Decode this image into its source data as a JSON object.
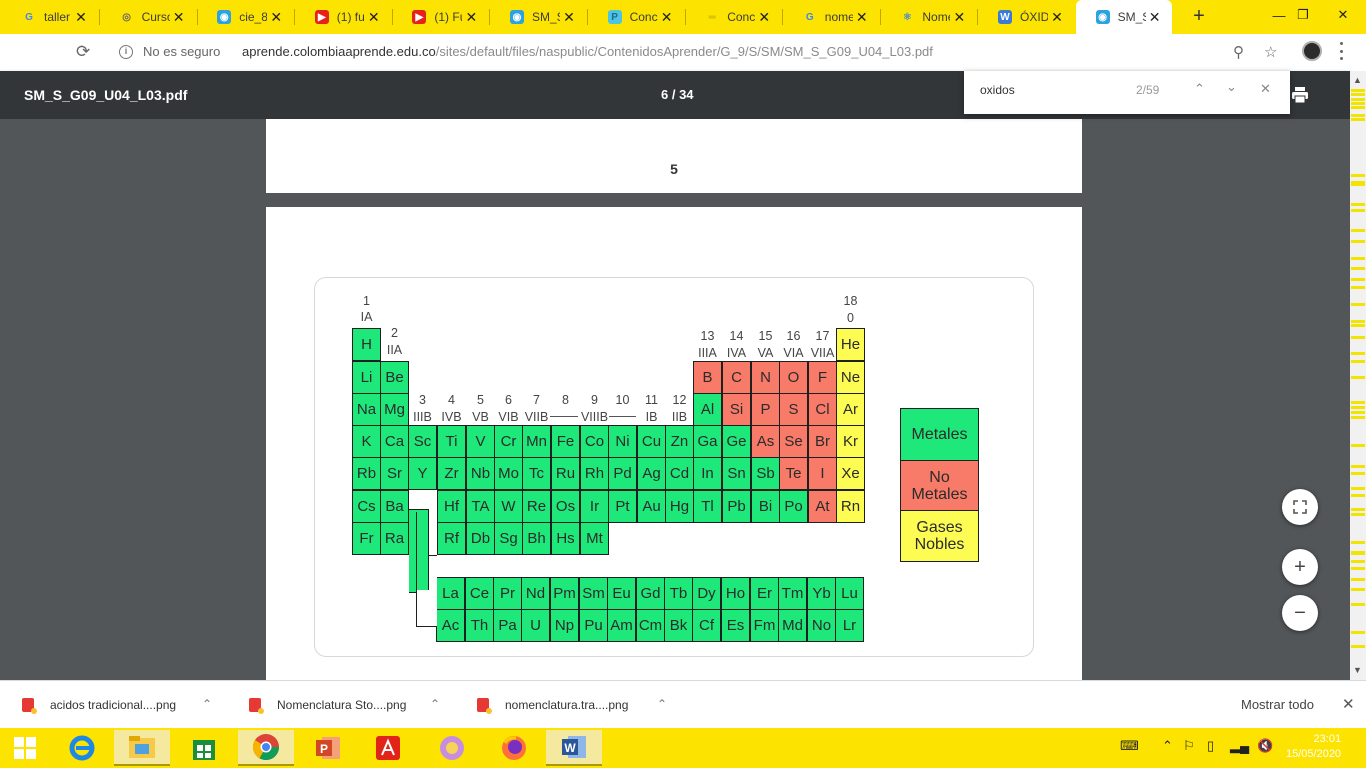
{
  "tabs": [
    {
      "label": "taller",
      "icon": "google-icon",
      "active": false
    },
    {
      "label": "Curso",
      "icon": "globe-icon",
      "active": false
    },
    {
      "label": "cie_8_",
      "icon": "site-icon",
      "active": false
    },
    {
      "label": "(1) fu",
      "icon": "youtube-icon",
      "active": false
    },
    {
      "label": "(1) Fu",
      "icon": "youtube-icon",
      "active": false
    },
    {
      "label": "SM_S",
      "icon": "site-icon",
      "active": false
    },
    {
      "label": "Conce",
      "icon": "p-icon",
      "active": false
    },
    {
      "label": "Conce",
      "icon": "doc-icon",
      "active": false
    },
    {
      "label": "nome",
      "icon": "google-icon",
      "active": false
    },
    {
      "label": "Nome",
      "icon": "atom-icon",
      "active": false
    },
    {
      "label": "ÓXID",
      "icon": "w-icon",
      "active": false
    },
    {
      "label": "SM_S",
      "icon": "site-icon",
      "active": true
    }
  ],
  "address": {
    "security": "No es seguro",
    "host": "aprende.colombiaaprende.edu.co",
    "path": "/sites/default/files/naspublic/ContenidosAprender/G_9/S/SM/SM_S_G09_U04_L03.pdf"
  },
  "pdf": {
    "title": "SM_S_G09_U04_L03.pdf",
    "page_indicator": "6 / 34",
    "page_number": "5"
  },
  "find": {
    "query": "oxidos",
    "count": "2/59"
  },
  "periodic_table": {
    "group_labels": [
      {
        "num": "1",
        "roman": "IA"
      },
      {
        "num": "2",
        "roman": "IIA"
      },
      {
        "num": "3",
        "roman": "IIIB"
      },
      {
        "num": "4",
        "roman": "IVB"
      },
      {
        "num": "5",
        "roman": "VB"
      },
      {
        "num": "6",
        "roman": "VIB"
      },
      {
        "num": "7",
        "roman": "VIIB"
      },
      {
        "num": "8",
        "roman": ""
      },
      {
        "num": "9",
        "roman": "VIIIB"
      },
      {
        "num": "10",
        "roman": ""
      },
      {
        "num": "11",
        "roman": "IB"
      },
      {
        "num": "12",
        "roman": "IIB"
      },
      {
        "num": "13",
        "roman": "IIIA"
      },
      {
        "num": "14",
        "roman": "IVA"
      },
      {
        "num": "15",
        "roman": "VA"
      },
      {
        "num": "16",
        "roman": "VIA"
      },
      {
        "num": "17",
        "roman": "VIIA"
      },
      {
        "num": "18",
        "roman": "0"
      }
    ],
    "elements": [
      {
        "s": "H",
        "r": 1,
        "c": 1,
        "t": "metal"
      },
      {
        "s": "He",
        "r": 1,
        "c": 18,
        "t": "noble"
      },
      {
        "s": "Li",
        "r": 2,
        "c": 1,
        "t": "metal"
      },
      {
        "s": "Be",
        "r": 2,
        "c": 2,
        "t": "metal"
      },
      {
        "s": "B",
        "r": 2,
        "c": 13,
        "t": "nonmetal"
      },
      {
        "s": "C",
        "r": 2,
        "c": 14,
        "t": "nonmetal"
      },
      {
        "s": "N",
        "r": 2,
        "c": 15,
        "t": "nonmetal"
      },
      {
        "s": "O",
        "r": 2,
        "c": 16,
        "t": "nonmetal"
      },
      {
        "s": "F",
        "r": 2,
        "c": 17,
        "t": "nonmetal"
      },
      {
        "s": "Ne",
        "r": 2,
        "c": 18,
        "t": "noble"
      },
      {
        "s": "Na",
        "r": 3,
        "c": 1,
        "t": "metal"
      },
      {
        "s": "Mg",
        "r": 3,
        "c": 2,
        "t": "metal"
      },
      {
        "s": "Al",
        "r": 3,
        "c": 13,
        "t": "metal"
      },
      {
        "s": "Si",
        "r": 3,
        "c": 14,
        "t": "nonmetal"
      },
      {
        "s": "P",
        "r": 3,
        "c": 15,
        "t": "nonmetal"
      },
      {
        "s": "S",
        "r": 3,
        "c": 16,
        "t": "nonmetal"
      },
      {
        "s": "Cl",
        "r": 3,
        "c": 17,
        "t": "nonmetal"
      },
      {
        "s": "Ar",
        "r": 3,
        "c": 18,
        "t": "noble"
      },
      {
        "s": "K",
        "r": 4,
        "c": 1,
        "t": "metal"
      },
      {
        "s": "Ca",
        "r": 4,
        "c": 2,
        "t": "metal"
      },
      {
        "s": "Sc",
        "r": 4,
        "c": 3,
        "t": "metal"
      },
      {
        "s": "Ti",
        "r": 4,
        "c": 4,
        "t": "metal"
      },
      {
        "s": "V",
        "r": 4,
        "c": 5,
        "t": "metal"
      },
      {
        "s": "Cr",
        "r": 4,
        "c": 6,
        "t": "metal"
      },
      {
        "s": "Mn",
        "r": 4,
        "c": 7,
        "t": "metal"
      },
      {
        "s": "Fe",
        "r": 4,
        "c": 8,
        "t": "metal"
      },
      {
        "s": "Co",
        "r": 4,
        "c": 9,
        "t": "metal"
      },
      {
        "s": "Ni",
        "r": 4,
        "c": 10,
        "t": "metal"
      },
      {
        "s": "Cu",
        "r": 4,
        "c": 11,
        "t": "metal"
      },
      {
        "s": "Zn",
        "r": 4,
        "c": 12,
        "t": "metal"
      },
      {
        "s": "Ga",
        "r": 4,
        "c": 13,
        "t": "metal"
      },
      {
        "s": "Ge",
        "r": 4,
        "c": 14,
        "t": "metal"
      },
      {
        "s": "As",
        "r": 4,
        "c": 15,
        "t": "nonmetal"
      },
      {
        "s": "Se",
        "r": 4,
        "c": 16,
        "t": "nonmetal"
      },
      {
        "s": "Br",
        "r": 4,
        "c": 17,
        "t": "nonmetal"
      },
      {
        "s": "Kr",
        "r": 4,
        "c": 18,
        "t": "noble"
      },
      {
        "s": "Rb",
        "r": 5,
        "c": 1,
        "t": "metal"
      },
      {
        "s": "Sr",
        "r": 5,
        "c": 2,
        "t": "metal"
      },
      {
        "s": "Y",
        "r": 5,
        "c": 3,
        "t": "metal"
      },
      {
        "s": "Zr",
        "r": 5,
        "c": 4,
        "t": "metal"
      },
      {
        "s": "Nb",
        "r": 5,
        "c": 5,
        "t": "metal"
      },
      {
        "s": "Mo",
        "r": 5,
        "c": 6,
        "t": "metal"
      },
      {
        "s": "Tc",
        "r": 5,
        "c": 7,
        "t": "metal"
      },
      {
        "s": "Ru",
        "r": 5,
        "c": 8,
        "t": "metal"
      },
      {
        "s": "Rh",
        "r": 5,
        "c": 9,
        "t": "metal"
      },
      {
        "s": "Pd",
        "r": 5,
        "c": 10,
        "t": "metal"
      },
      {
        "s": "Ag",
        "r": 5,
        "c": 11,
        "t": "metal"
      },
      {
        "s": "Cd",
        "r": 5,
        "c": 12,
        "t": "metal"
      },
      {
        "s": "In",
        "r": 5,
        "c": 13,
        "t": "metal"
      },
      {
        "s": "Sn",
        "r": 5,
        "c": 14,
        "t": "metal"
      },
      {
        "s": "Sb",
        "r": 5,
        "c": 15,
        "t": "metal"
      },
      {
        "s": "Te",
        "r": 5,
        "c": 16,
        "t": "nonmetal"
      },
      {
        "s": "I",
        "r": 5,
        "c": 17,
        "t": "nonmetal"
      },
      {
        "s": "Xe",
        "r": 5,
        "c": 18,
        "t": "noble"
      },
      {
        "s": "Cs",
        "r": 6,
        "c": 1,
        "t": "metal"
      },
      {
        "s": "Ba",
        "r": 6,
        "c": 2,
        "t": "metal"
      },
      {
        "s": "Hf",
        "r": 6,
        "c": 4,
        "t": "metal"
      },
      {
        "s": "TA",
        "r": 6,
        "c": 5,
        "t": "metal"
      },
      {
        "s": "W",
        "r": 6,
        "c": 6,
        "t": "metal"
      },
      {
        "s": "Re",
        "r": 6,
        "c": 7,
        "t": "metal"
      },
      {
        "s": "Os",
        "r": 6,
        "c": 8,
        "t": "metal"
      },
      {
        "s": "Ir",
        "r": 6,
        "c": 9,
        "t": "metal"
      },
      {
        "s": "Pt",
        "r": 6,
        "c": 10,
        "t": "metal"
      },
      {
        "s": "Au",
        "r": 6,
        "c": 11,
        "t": "metal"
      },
      {
        "s": "Hg",
        "r": 6,
        "c": 12,
        "t": "metal"
      },
      {
        "s": "Tl",
        "r": 6,
        "c": 13,
        "t": "metal"
      },
      {
        "s": "Pb",
        "r": 6,
        "c": 14,
        "t": "metal"
      },
      {
        "s": "Bi",
        "r": 6,
        "c": 15,
        "t": "metal"
      },
      {
        "s": "Po",
        "r": 6,
        "c": 16,
        "t": "metal"
      },
      {
        "s": "At",
        "r": 6,
        "c": 17,
        "t": "nonmetal"
      },
      {
        "s": "Rn",
        "r": 6,
        "c": 18,
        "t": "noble"
      },
      {
        "s": "Fr",
        "r": 7,
        "c": 1,
        "t": "metal"
      },
      {
        "s": "Ra",
        "r": 7,
        "c": 2,
        "t": "metal"
      },
      {
        "s": "Rf",
        "r": 7,
        "c": 4,
        "t": "metal"
      },
      {
        "s": "Db",
        "r": 7,
        "c": 5,
        "t": "metal"
      },
      {
        "s": "Sg",
        "r": 7,
        "c": 6,
        "t": "metal"
      },
      {
        "s": "Bh",
        "r": 7,
        "c": 7,
        "t": "metal"
      },
      {
        "s": "Hs",
        "r": 7,
        "c": 8,
        "t": "metal"
      },
      {
        "s": "Mt",
        "r": 7,
        "c": 9,
        "t": "metal"
      }
    ],
    "lanthanides": [
      "La",
      "Ce",
      "Pr",
      "Nd",
      "Pm",
      "Sm",
      "Eu",
      "Gd",
      "Tb",
      "Dy",
      "Ho",
      "Er",
      "Tm",
      "Yb",
      "Lu"
    ],
    "actinides": [
      "Ac",
      "Th",
      "Pa",
      "U",
      "Np",
      "Pu",
      "Am",
      "Cm",
      "Bk",
      "Cf",
      "Es",
      "Fm",
      "Md",
      "No",
      "Lr"
    ],
    "legend": {
      "metals": "Metales",
      "nonmetals_line1": "No",
      "nonmetals_line2": "Metales",
      "noble_line1": "Gases",
      "noble_line2": "Nobles"
    }
  },
  "downloads": [
    {
      "name": "acidos tradicional....png"
    },
    {
      "name": "Nomenclatura Sto....png"
    },
    {
      "name": "nomenclatura.tra....png"
    }
  ],
  "downloads_show_all": "Mostrar todo",
  "clock": {
    "time": "23:01",
    "date": "15/05/2020"
  },
  "colors": {
    "tabstrip": "#fce400",
    "pdf_toolbar": "#323639",
    "pdf_background": "#525659",
    "metal": "#1ee87a",
    "nonmetal": "#f87a68",
    "noble": "#fcfc52"
  }
}
